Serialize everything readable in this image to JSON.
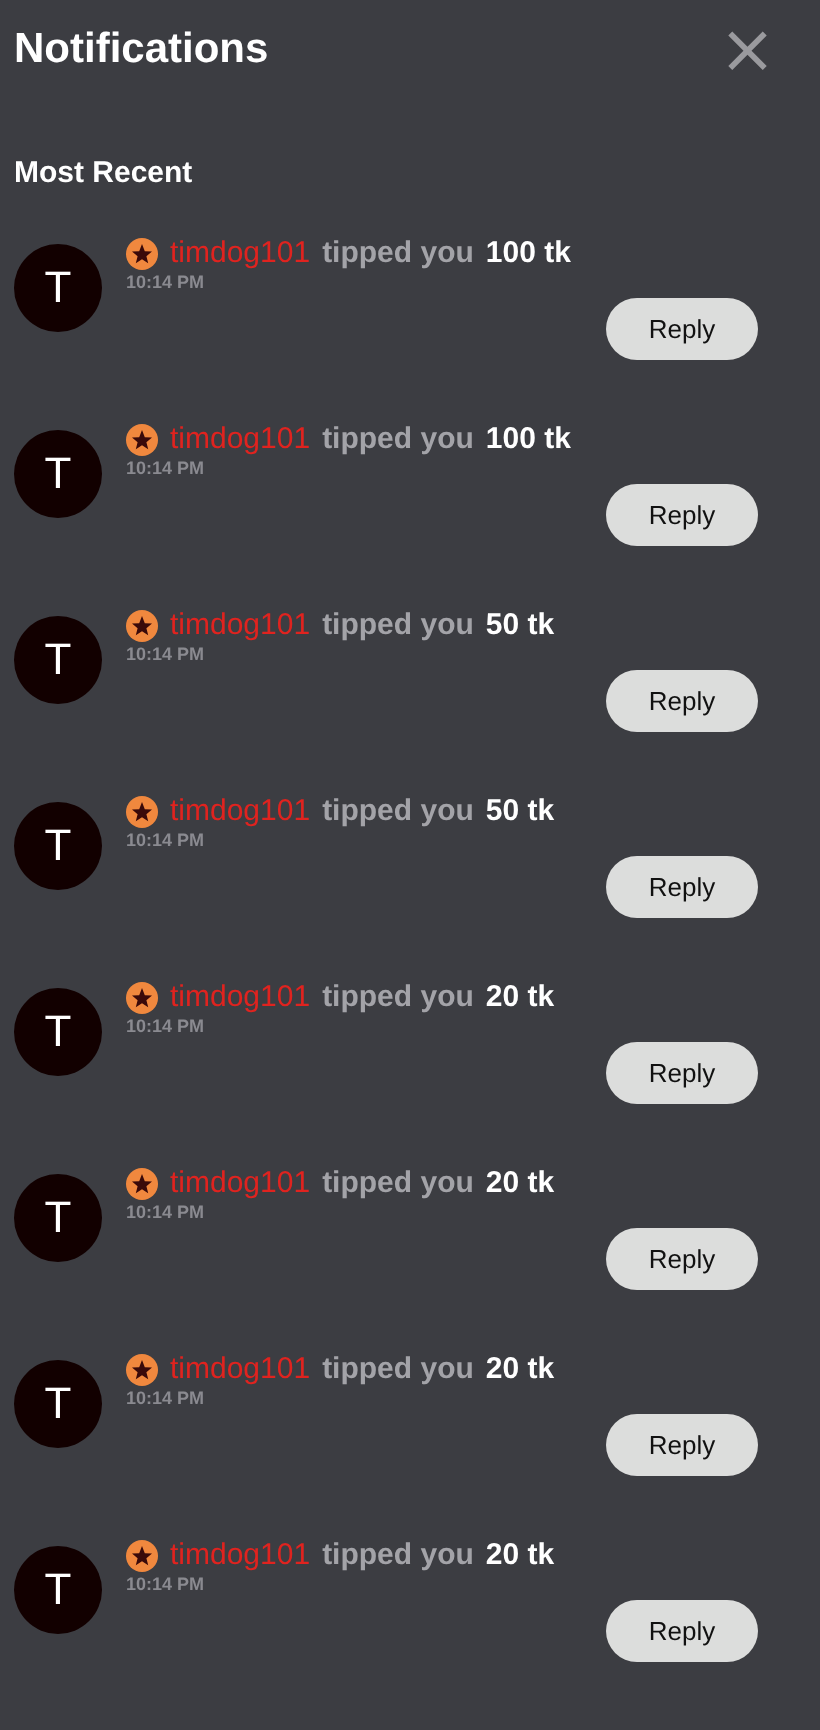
{
  "header": {
    "title": "Notifications",
    "close": "×"
  },
  "section": {
    "title": "Most Recent"
  },
  "notifications": [
    {
      "avatar": "T",
      "user": "timdog101",
      "action": "tipped you",
      "amount": "100 tk",
      "time": "10:14 PM",
      "button": "Reply"
    },
    {
      "avatar": "T",
      "user": "timdog101",
      "action": "tipped you",
      "amount": "100 tk",
      "time": "10:14 PM",
      "button": "Reply"
    },
    {
      "avatar": "T",
      "user": "timdog101",
      "action": "tipped you",
      "amount": "50 tk",
      "time": "10:14 PM",
      "button": "Reply"
    },
    {
      "avatar": "T",
      "user": "timdog101",
      "action": "tipped you",
      "amount": "50 tk",
      "time": "10:14 PM",
      "button": "Reply"
    },
    {
      "avatar": "T",
      "user": "timdog101",
      "action": "tipped you",
      "amount": "20 tk",
      "time": "10:14 PM",
      "button": "Reply"
    },
    {
      "avatar": "T",
      "user": "timdog101",
      "action": "tipped you",
      "amount": "20 tk",
      "time": "10:14 PM",
      "button": "Reply"
    },
    {
      "avatar": "T",
      "user": "timdog101",
      "action": "tipped you",
      "amount": "20 tk",
      "time": "10:14 PM",
      "button": "Reply"
    },
    {
      "avatar": "T",
      "user": "timdog101",
      "action": "tipped you",
      "amount": "20 tk",
      "time": "10:14 PM",
      "button": "Reply"
    }
  ]
}
